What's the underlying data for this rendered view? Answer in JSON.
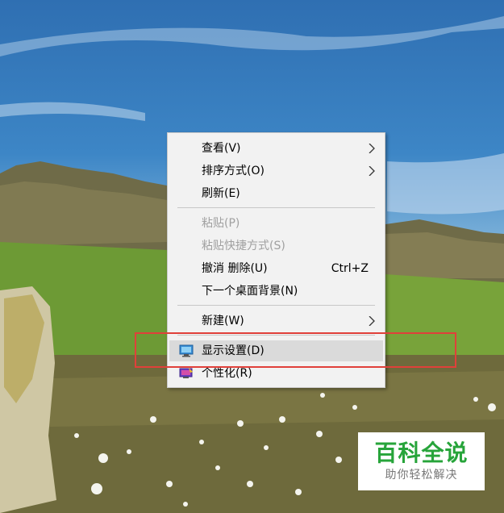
{
  "context_menu": {
    "items": [
      {
        "label": "查看(V)",
        "shortcut": "",
        "submenu": true,
        "enabled": true
      },
      {
        "label": "排序方式(O)",
        "shortcut": "",
        "submenu": true,
        "enabled": true
      },
      {
        "label": "刷新(E)",
        "shortcut": "",
        "submenu": false,
        "enabled": true
      },
      {
        "label": "粘贴(P)",
        "shortcut": "",
        "submenu": false,
        "enabled": false
      },
      {
        "label": "粘贴快捷方式(S)",
        "shortcut": "",
        "submenu": false,
        "enabled": false
      },
      {
        "label": "撤消 删除(U)",
        "shortcut": "Ctrl+Z",
        "submenu": false,
        "enabled": true
      },
      {
        "label": "下一个桌面背景(N)",
        "shortcut": "",
        "submenu": false,
        "enabled": true
      },
      {
        "label": "新建(W)",
        "shortcut": "",
        "submenu": true,
        "enabled": true
      },
      {
        "label": "显示设置(D)",
        "shortcut": "",
        "submenu": false,
        "enabled": true,
        "icon": "display-settings-icon",
        "highlighted": true
      },
      {
        "label": "个性化(R)",
        "shortcut": "",
        "submenu": false,
        "enabled": true,
        "icon": "personalize-icon"
      }
    ]
  },
  "annotation": {
    "color": "#e0403a"
  },
  "watermark": {
    "title": "百科全说",
    "subtitle": "助你轻松解决",
    "color": "#27a43a"
  }
}
